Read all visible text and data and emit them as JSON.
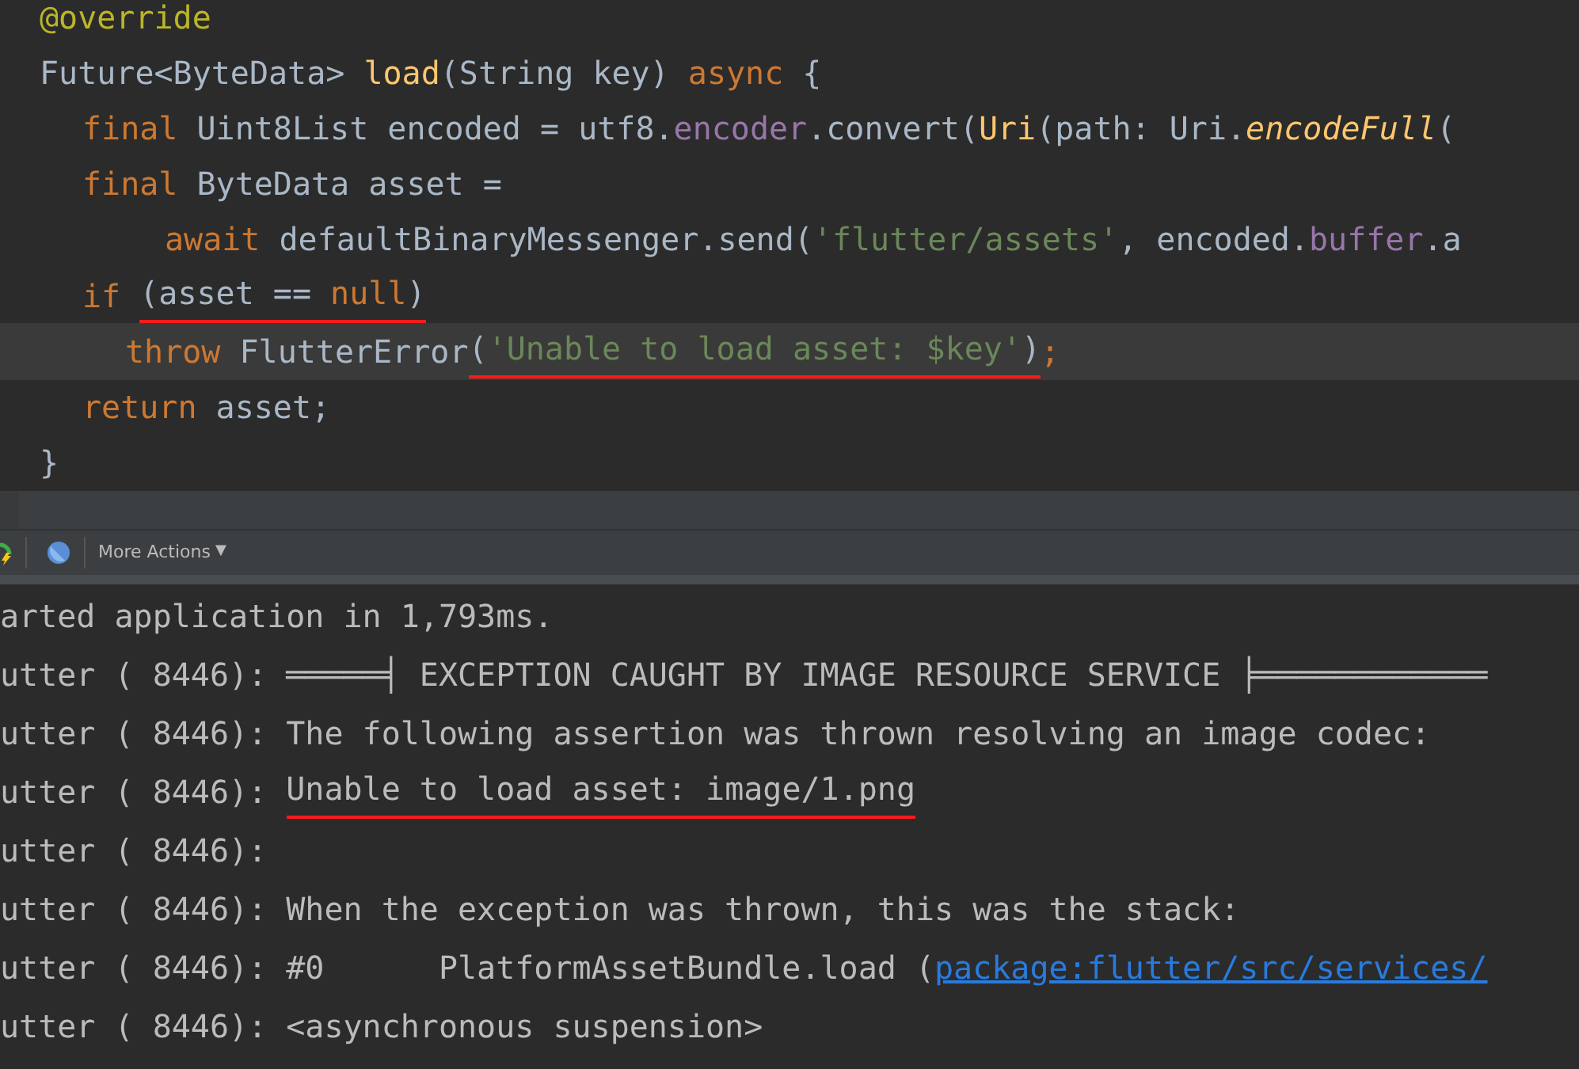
{
  "editor": {
    "lines": [
      {
        "current": false,
        "tokens": [
          {
            "kind": "annotation",
            "text": "@override"
          }
        ]
      },
      {
        "current": false,
        "tokens": [
          {
            "kind": "plain",
            "text": "Future<ByteData> "
          },
          {
            "kind": "method",
            "text": "load"
          },
          {
            "kind": "plain",
            "text": "(String key) "
          },
          {
            "kind": "keyword",
            "text": "async"
          },
          {
            "kind": "plain",
            "text": " {"
          }
        ]
      },
      {
        "current": false,
        "tokens": [
          {
            "kind": "keyword",
            "text": "final"
          },
          {
            "kind": "plain",
            "text": " Uint8List encoded = utf8."
          },
          {
            "kind": "field",
            "text": "encoder"
          },
          {
            "kind": "plain",
            "text": ".convert("
          },
          {
            "kind": "method",
            "text": "Uri"
          },
          {
            "kind": "plain",
            "text": "(path: Uri."
          },
          {
            "kind": "static",
            "text": "encodeFull"
          },
          {
            "kind": "plain",
            "text": "("
          }
        ]
      },
      {
        "current": false,
        "tokens": [
          {
            "kind": "keyword",
            "text": "final"
          },
          {
            "kind": "plain",
            "text": " ByteData asset ="
          }
        ]
      },
      {
        "current": false,
        "tokens": [
          {
            "kind": "keyword",
            "text": "await"
          },
          {
            "kind": "plain",
            "text": " defaultBinaryMessenger.send("
          },
          {
            "kind": "string",
            "text": "'flutter/assets'"
          },
          {
            "kind": "plain",
            "text": ", encoded."
          },
          {
            "kind": "field",
            "text": "buffer"
          },
          {
            "kind": "plain",
            "text": ".a"
          }
        ]
      },
      {
        "current": false,
        "tokens": [
          {
            "kind": "keyword",
            "text": "if "
          },
          {
            "kind": "plain",
            "text": "(asset == ",
            "underlined": true
          },
          {
            "kind": "keyword",
            "text": "null",
            "underlined": true
          },
          {
            "kind": "plain",
            "text": ")",
            "underlined": true
          }
        ]
      },
      {
        "current": true,
        "tokens": [
          {
            "kind": "keyword",
            "text": "throw"
          },
          {
            "kind": "plain",
            "text": " FlutterError"
          },
          {
            "kind": "plain",
            "text": "(",
            "underlined": true
          },
          {
            "kind": "string",
            "text": "'Unable to load asset: $key'",
            "underlined": true
          },
          {
            "kind": "plain",
            "text": ")",
            "underlined": true
          },
          {
            "kind": "keyword",
            "text": ";"
          }
        ]
      },
      {
        "current": false,
        "tokens": [
          {
            "kind": "keyword",
            "text": "return"
          },
          {
            "kind": "plain",
            "text": " asset;"
          }
        ]
      },
      {
        "current": false,
        "tokens": [
          {
            "kind": "plain",
            "text": "}"
          }
        ]
      }
    ]
  },
  "toolbar": {
    "more_actions": "More Actions",
    "caret": "▼"
  },
  "console": {
    "lines": [
      {
        "segments": [
          {
            "kind": "text",
            "text": "arted application in 1,793ms."
          }
        ]
      },
      {
        "segments": [
          {
            "kind": "text",
            "text": "utter ( 8446): ═════╡ EXCEPTION CAUGHT BY IMAGE RESOURCE SERVICE ╞════════════"
          }
        ]
      },
      {
        "segments": [
          {
            "kind": "text",
            "text": "utter ( 8446): The following assertion was thrown resolving an image codec:"
          }
        ]
      },
      {
        "segments": [
          {
            "kind": "text",
            "text": "utter ( 8446): "
          },
          {
            "kind": "text",
            "text": "Unable to load asset: image/1.png",
            "underlined": true
          }
        ]
      },
      {
        "segments": [
          {
            "kind": "text",
            "text": "utter ( 8446):"
          }
        ]
      },
      {
        "segments": [
          {
            "kind": "text",
            "text": "utter ( 8446): When the exception was thrown, this was the stack:"
          }
        ]
      },
      {
        "segments": [
          {
            "kind": "text",
            "text": "utter ( 8446): #0      PlatformAssetBundle.load ("
          },
          {
            "kind": "link",
            "text": "package:flutter/src/services/"
          }
        ]
      },
      {
        "segments": [
          {
            "kind": "text",
            "text": "utter ( 8446): <asynchronous suspension>"
          }
        ]
      }
    ]
  }
}
